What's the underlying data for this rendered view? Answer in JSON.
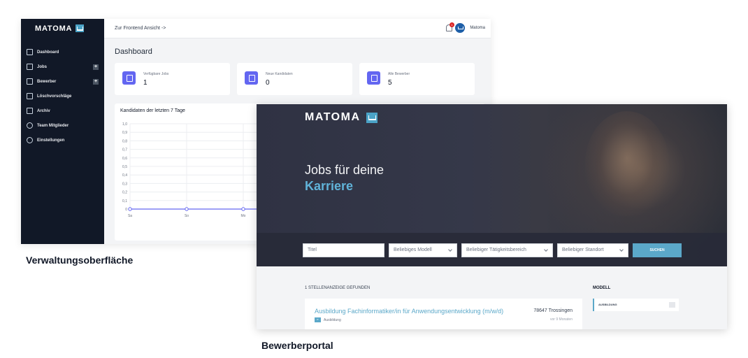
{
  "admin": {
    "brand": "MATOMA",
    "nav": [
      {
        "label": "Dashboard",
        "icon": "home-icon",
        "plus": false
      },
      {
        "label": "Jobs",
        "icon": "folder-icon",
        "plus": true
      },
      {
        "label": "Bewerber",
        "icon": "document-icon",
        "plus": true
      },
      {
        "label": "Löschvorschläge",
        "icon": "trash-icon",
        "plus": false
      },
      {
        "label": "Archiv",
        "icon": "archive-icon",
        "plus": false
      },
      {
        "label": "Team Mitglieder",
        "icon": "users-icon",
        "plus": false
      },
      {
        "label": "Einstellungen",
        "icon": "gear-icon",
        "plus": false
      }
    ],
    "topbar": {
      "frontend_link": "Zur Frontend Ansicht ->",
      "notification_count": "1",
      "user_name": "Matoma"
    },
    "page_title": "Dashboard",
    "stats": [
      {
        "label": "Verfügbare Jobs",
        "value": "1",
        "icon": "briefcase-icon"
      },
      {
        "label": "Neue Kandidaten",
        "value": "0",
        "icon": "user-icon"
      },
      {
        "label": "Alle Bewerber",
        "value": "5",
        "icon": "document-icon"
      }
    ],
    "chart_data": {
      "type": "line",
      "title": "Kandidaten der letzten 7 Tage",
      "categories": [
        "Sa",
        "So",
        "Mo"
      ],
      "values": [
        0,
        0,
        0
      ],
      "ylim": [
        0,
        1.0
      ],
      "yticks": [
        "0",
        "0,1",
        "0,2",
        "0,3",
        "0,4",
        "0,5",
        "0,6",
        "0,7",
        "0,8",
        "0,9",
        "1,0"
      ],
      "grid": true,
      "color": "#6366f1"
    },
    "caption": "Verwaltungsoberfläche"
  },
  "portal": {
    "brand": "MATOMA",
    "hero_line1": "Jobs für deine",
    "hero_line2": "Karriere",
    "search": {
      "title_placeholder": "Titel",
      "model": "Beliebiges Modell",
      "area": "Beliebiger Tätigkeitsbereich",
      "location": "Beliebiger Standort",
      "button": "SUCHEN"
    },
    "results_count": "1 STELLENANZEIGE GEFUNDEN",
    "job": {
      "title": "Ausbildung Fachinformatiker/in für Anwendungsentwicklung (m/w/d)",
      "badge": "IT",
      "type": "Ausbildung",
      "location": "78647 Trossingen",
      "age": "vor 9 Monaten"
    },
    "filter": {
      "title": "MODELL",
      "item": "AUSBILDUNG"
    },
    "caption": "Bewerberportal"
  },
  "colors": {
    "sidebar": "#111827",
    "accent": "#6366f1",
    "portal_accent": "#5ba8c9"
  }
}
